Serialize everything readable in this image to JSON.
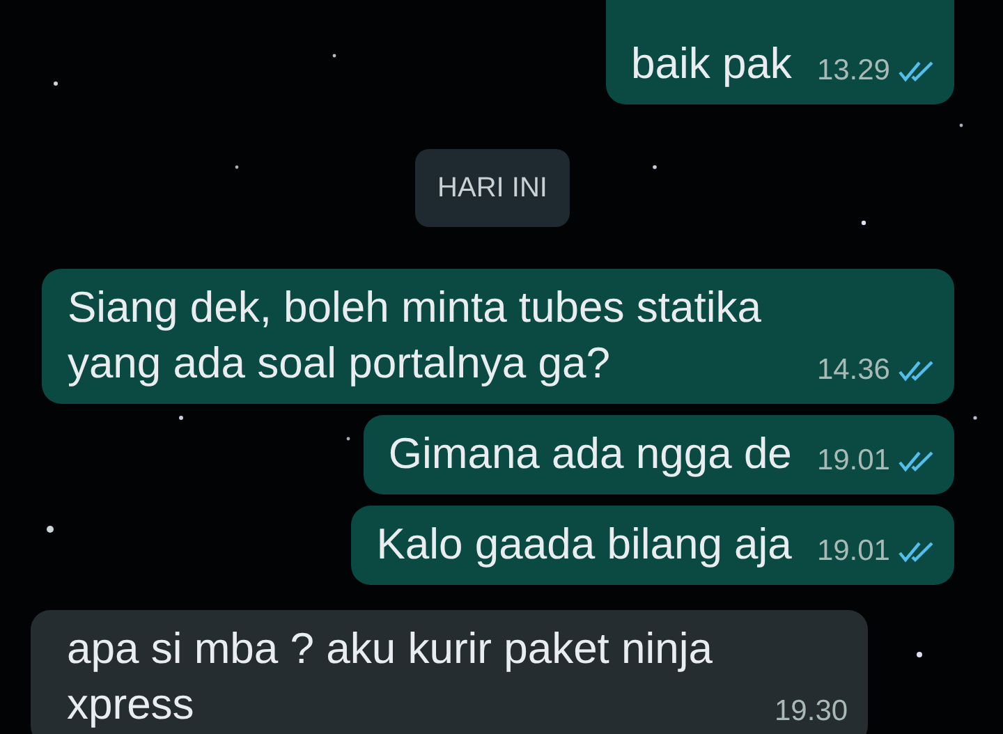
{
  "messages": [
    {
      "kind": "outgoing",
      "text": "baik pak",
      "time": "13.29",
      "read": true
    },
    {
      "kind": "date",
      "text": "HARI INI"
    },
    {
      "kind": "outgoing",
      "text": "Siang dek, boleh minta tubes statika yang ada soal portalnya ga?",
      "time": "14.36",
      "read": true
    },
    {
      "kind": "outgoing",
      "text": "Gimana ada ngga de",
      "time": "19.01",
      "read": true
    },
    {
      "kind": "outgoing",
      "text": "Kalo gaada bilang aja",
      "time": "19.01",
      "read": true
    },
    {
      "kind": "incoming",
      "text": "apa si mba ? aku kurir paket ninja xpress",
      "time": "19.30"
    }
  ]
}
